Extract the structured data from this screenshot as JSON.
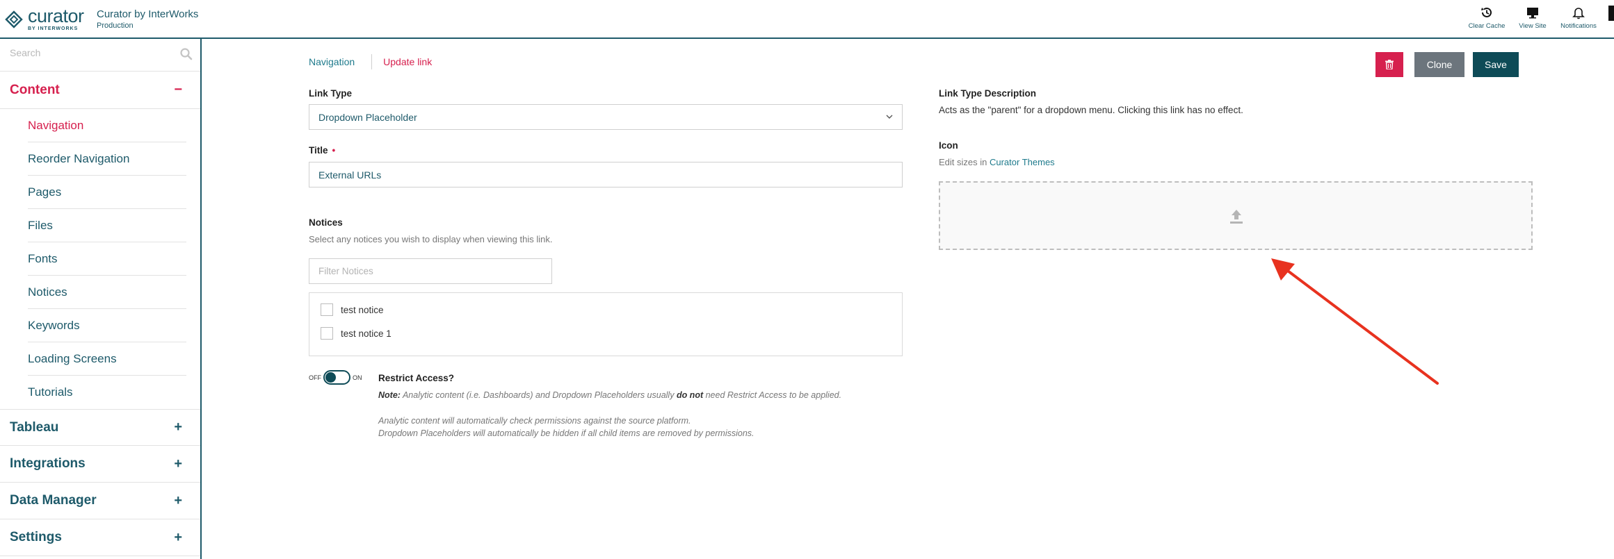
{
  "header": {
    "logo_word": "curator",
    "logo_sub": "BY INTERWORKS",
    "site_title": "Curator by InterWorks",
    "site_env": "Production",
    "actions": [
      {
        "icon": "clear-cache-icon",
        "label": "Clear Cache"
      },
      {
        "icon": "monitor-icon",
        "label": "View Site"
      },
      {
        "icon": "bell-icon",
        "label": "Notifications"
      }
    ]
  },
  "sidebar": {
    "search_placeholder": "Search",
    "content": {
      "label": "Content",
      "toggle": "−",
      "items": [
        "Navigation",
        "Reorder Navigation",
        "Pages",
        "Files",
        "Fonts",
        "Notices",
        "Keywords",
        "Loading Screens",
        "Tutorials"
      ]
    },
    "sections": [
      {
        "label": "Tableau",
        "toggle": "+"
      },
      {
        "label": "Integrations",
        "toggle": "+"
      },
      {
        "label": "Data Manager",
        "toggle": "+"
      },
      {
        "label": "Settings",
        "toggle": "+"
      }
    ]
  },
  "breadcrumb": {
    "nav": "Navigation",
    "current": "Update link"
  },
  "buttons": {
    "clone": "Clone",
    "save": "Save"
  },
  "form": {
    "link_type_label": "Link Type",
    "link_type_value": "Dropdown Placeholder",
    "title_label": "Title",
    "title_required": "•",
    "title_value": "External URLs",
    "notices_label": "Notices",
    "notices_help": "Select any notices you wish to display when viewing this link.",
    "filter_placeholder": "Filter Notices",
    "notices": [
      "test notice",
      "test notice 1"
    ],
    "switch_off": "OFF",
    "switch_on": "ON",
    "restrict_title": "Restrict Access?",
    "restrict_note_prefix": "Note:",
    "restrict_note_a": " Analytic content (i.e. Dashboards) and Dropdown Placeholders usually ",
    "restrict_note_bold": "do not",
    "restrict_note_b": " need Restrict Access to be applied.",
    "restrict_line1": "Analytic content will automatically check permissions against the source platform.",
    "restrict_line2": "Dropdown Placeholders will automatically be hidden if all child items are removed by permissions."
  },
  "right": {
    "desc_title": "Link Type Description",
    "desc_text": "Acts as the \"parent\" for a dropdown menu. Clicking this link has no effect.",
    "icon_title": "Icon",
    "icon_help": "Edit sizes in ",
    "icon_help_link": "Curator Themes"
  },
  "colors": {
    "primary": "#1e5a6a",
    "accent": "#d6204e",
    "save": "#0e4b57",
    "clone": "#6c757d",
    "arrow": "#e8321f"
  }
}
